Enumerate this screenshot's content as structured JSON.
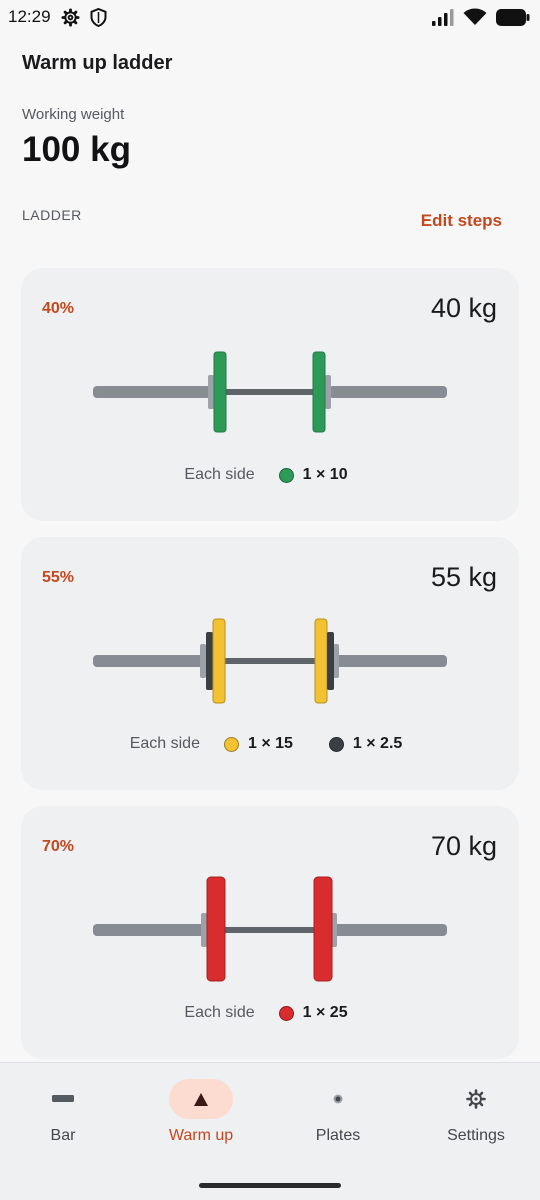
{
  "status": {
    "time": "12:29"
  },
  "header": {
    "title": "Warm up ladder",
    "weight_label": "Working weight",
    "weight_value": "100 kg"
  },
  "ladder": {
    "section_label": "LADDER",
    "edit_label": "Edit steps",
    "steps": [
      {
        "percent": "40%",
        "weight": "40 kg",
        "each_side_label": "Each side",
        "plates": [
          {
            "text": "1 × 10",
            "color": "#2e9a58"
          }
        ]
      },
      {
        "percent": "55%",
        "weight": "55 kg",
        "each_side_label": "Each side",
        "plates": [
          {
            "text": "1 × 15",
            "color": "#f2c233"
          },
          {
            "text": "1 × 2.5",
            "color": "#3a3f46"
          }
        ]
      },
      {
        "percent": "70%",
        "weight": "70 kg",
        "each_side_label": "Each side",
        "plates": [
          {
            "text": "1 × 25",
            "color": "#d92c2e"
          }
        ]
      }
    ]
  },
  "nav": {
    "items": [
      {
        "label": "Bar",
        "icon": "bar-icon"
      },
      {
        "label": "Warm up",
        "icon": "triangle-icon",
        "active": true
      },
      {
        "label": "Plates",
        "icon": "plate-dot-icon"
      },
      {
        "label": "Settings",
        "icon": "gear-icon"
      }
    ]
  },
  "colors": {
    "accent": "#c2481f",
    "card": "#eff0f2",
    "bar": "#878c94",
    "active_pill": "#fcdcd0"
  }
}
